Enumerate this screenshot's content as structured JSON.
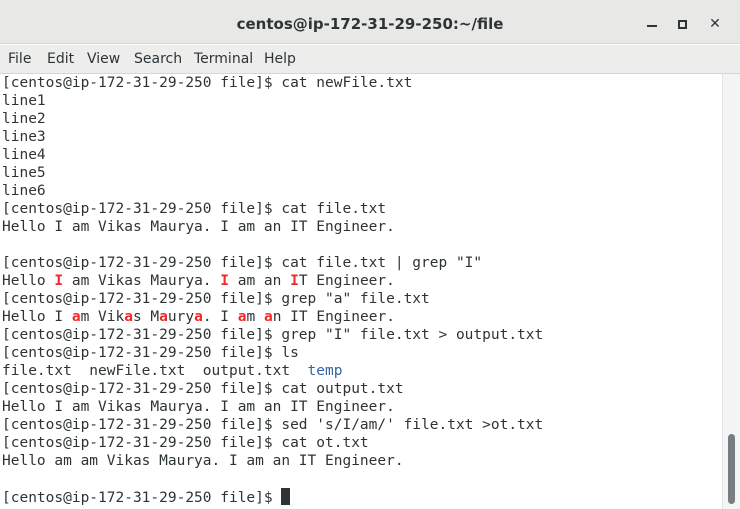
{
  "window": {
    "title": "centos@ip-172-31-29-250:~/file",
    "minimize_label": "_",
    "maximize_label": "□",
    "close_label": "✕"
  },
  "menu": [
    "File",
    "Edit",
    "View",
    "Search",
    "Terminal",
    "Help"
  ],
  "colors": {
    "match_highlight": "#ef2929",
    "directory": "#3465a4",
    "text": "#2e3436"
  },
  "terminal": {
    "lines": [
      [
        {
          "t": "[centos@ip-172-31-29-250 file]$ cat newFile.txt"
        }
      ],
      [
        {
          "t": "line1"
        }
      ],
      [
        {
          "t": "line2"
        }
      ],
      [
        {
          "t": "line3"
        }
      ],
      [
        {
          "t": "line4"
        }
      ],
      [
        {
          "t": "line5"
        }
      ],
      [
        {
          "t": "line6"
        }
      ],
      [
        {
          "t": "[centos@ip-172-31-29-250 file]$ cat file.txt"
        }
      ],
      [
        {
          "t": "Hello I am Vikas Maurya. I am an IT Engineer."
        }
      ],
      [
        {
          "t": ""
        }
      ],
      [
        {
          "t": "[centos@ip-172-31-29-250 file]$ cat file.txt | grep \"I\""
        }
      ],
      [
        {
          "t": "Hello "
        },
        {
          "t": "I",
          "hl": true
        },
        {
          "t": " am Vikas Maurya. "
        },
        {
          "t": "I",
          "hl": true
        },
        {
          "t": " am an "
        },
        {
          "t": "I",
          "hl": true
        },
        {
          "t": "T Engineer."
        }
      ],
      [
        {
          "t": "[centos@ip-172-31-29-250 file]$ grep \"a\" file.txt"
        }
      ],
      [
        {
          "t": "Hello I "
        },
        {
          "t": "a",
          "hl": true
        },
        {
          "t": "m Vik"
        },
        {
          "t": "a",
          "hl": true
        },
        {
          "t": "s M"
        },
        {
          "t": "a",
          "hl": true
        },
        {
          "t": "ury"
        },
        {
          "t": "a",
          "hl": true
        },
        {
          "t": ". I "
        },
        {
          "t": "a",
          "hl": true
        },
        {
          "t": "m "
        },
        {
          "t": "a",
          "hl": true
        },
        {
          "t": "n IT Engineer."
        }
      ],
      [
        {
          "t": "[centos@ip-172-31-29-250 file]$ grep \"I\" file.txt > output.txt"
        }
      ],
      [
        {
          "t": "[centos@ip-172-31-29-250 file]$ ls"
        }
      ],
      [
        {
          "t": "file.txt  newFile.txt  output.txt  "
        },
        {
          "t": "temp",
          "dir": true
        }
      ],
      [
        {
          "t": "[centos@ip-172-31-29-250 file]$ cat output.txt"
        }
      ],
      [
        {
          "t": "Hello I am Vikas Maurya. I am an IT Engineer."
        }
      ],
      [
        {
          "t": "[centos@ip-172-31-29-250 file]$ sed 's/I/am/' file.txt >ot.txt"
        }
      ],
      [
        {
          "t": "[centos@ip-172-31-29-250 file]$ cat ot.txt"
        }
      ],
      [
        {
          "t": "Hello am am Vikas Maurya. I am an IT Engineer."
        }
      ],
      [
        {
          "t": ""
        }
      ],
      [
        {
          "t": "[centos@ip-172-31-29-250 file]$ "
        },
        {
          "cursor": true
        }
      ]
    ]
  }
}
